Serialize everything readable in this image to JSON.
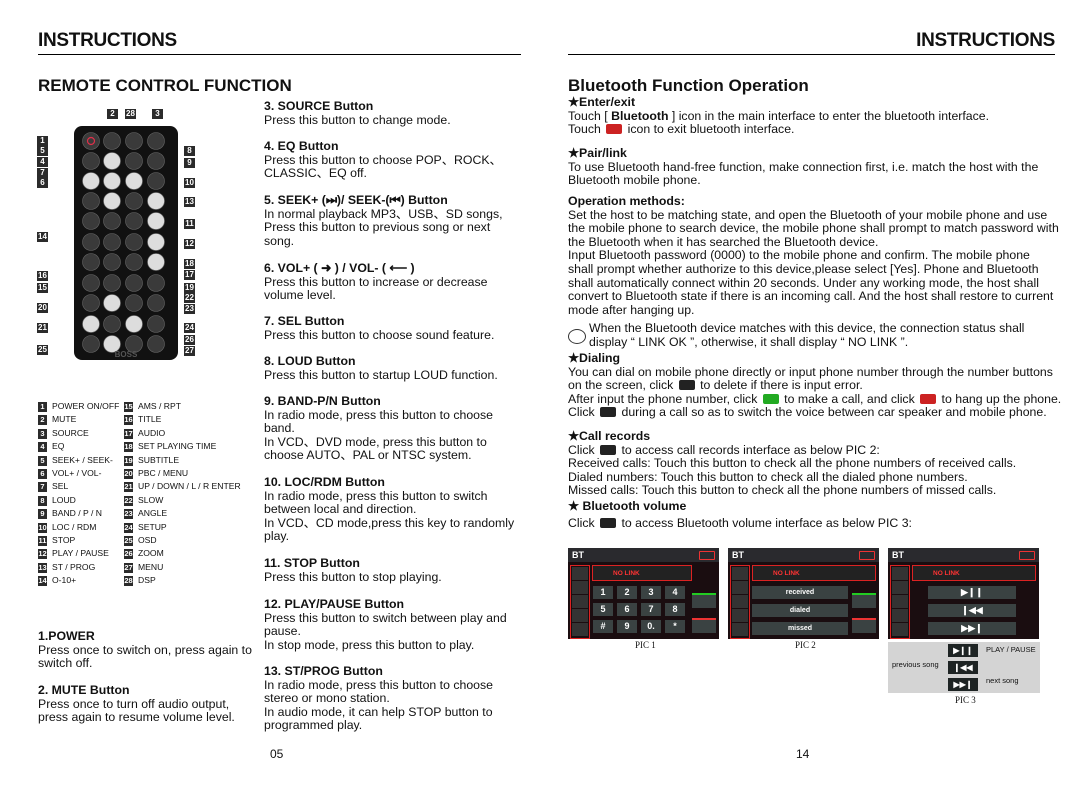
{
  "header": {
    "left": "INSTRUCTIONS",
    "right": "INSTRUCTIONS"
  },
  "left": {
    "section_title": "REMOTE CONTROL FUNCTION",
    "callouts": [
      "1",
      "2",
      "3",
      "4",
      "5",
      "6",
      "7",
      "8",
      "9",
      "10",
      "11",
      "12",
      "13",
      "14",
      "15",
      "16",
      "17",
      "18",
      "19",
      "20",
      "21",
      "22",
      "23",
      "24",
      "25",
      "26",
      "27",
      "28"
    ],
    "remote_brand": "BOSS",
    "legend": [
      [
        "1",
        "POWER ON/OFF"
      ],
      [
        "2",
        "MUTE"
      ],
      [
        "3",
        "SOURCE"
      ],
      [
        "4",
        "EQ"
      ],
      [
        "5",
        "SEEK+ / SEEK-"
      ],
      [
        "6",
        "VOL+ / VOL-"
      ],
      [
        "7",
        "SEL"
      ],
      [
        "8",
        "LOUD"
      ],
      [
        "9",
        "BAND / P / N"
      ],
      [
        "10",
        "LOC / RDM"
      ],
      [
        "11",
        "STOP"
      ],
      [
        "12",
        "PLAY / PAUSE"
      ],
      [
        "13",
        "ST / PROG"
      ],
      [
        "14",
        "O-10+"
      ],
      [
        "15",
        "AMS / RPT"
      ],
      [
        "16",
        "TITLE"
      ],
      [
        "17",
        "AUDIO"
      ],
      [
        "18",
        "SET PLAYING TIME"
      ],
      [
        "19",
        "SUBTITLE"
      ],
      [
        "20",
        "PBC / MENU"
      ],
      [
        "21",
        "UP / DOWN / L / R ENTER"
      ],
      [
        "22",
        "SLOW"
      ],
      [
        "23",
        "ANGLE"
      ],
      [
        "24",
        "SETUP"
      ],
      [
        "25",
        "OSD"
      ],
      [
        "26",
        "ZOOM"
      ],
      [
        "27",
        "MENU"
      ],
      [
        "28",
        "DSP"
      ]
    ],
    "items": [
      {
        "title": "1.POWER",
        "lines": [
          "Press once to switch on, press again to",
          "switch off."
        ]
      },
      {
        "title": "2. MUTE Button",
        "lines": [
          "Press once to turn off audio output,",
          "press again to resume volume level."
        ]
      },
      {
        "title": "3. SOURCE Button",
        "lines": [
          "Press this button to change mode."
        ]
      },
      {
        "title": "4. EQ Button",
        "lines": [
          "Press this button to choose POP、ROCK、",
          "CLASSIC、EQ off."
        ]
      },
      {
        "title": "5. SEEK+ (⏭)/ SEEK-(⏮) Button",
        "lines": [
          "In normal playback MP3、USB、SD songs,",
          "Press this button to previous song or next",
          "song."
        ]
      },
      {
        "title": "6. VOL+ ( ➜ ) / VOL- ( ⟵ )",
        "lines": [
          "Press this button to increase or decrease",
          "volume level."
        ]
      },
      {
        "title": "7. SEL Button",
        "lines": [
          "Press this button to choose sound feature."
        ]
      },
      {
        "title": "8. LOUD Button",
        "lines": [
          "Press this button to startup LOUD function."
        ]
      },
      {
        "title": "9. BAND-P/N Button",
        "lines": [
          "In radio mode, press this button to choose",
          "band.",
          "In VCD、DVD mode, press this button to",
          "choose AUTO、PAL or NTSC system."
        ]
      },
      {
        "title": "10. LOC/RDM Button",
        "lines": [
          "In radio mode, press this button to switch",
          "between local and direction.",
          "In VCD、CD mode,press this key to randomly",
          "play."
        ]
      },
      {
        "title": "11. STOP Button",
        "lines": [
          "Press this button to stop playing."
        ]
      },
      {
        "title": "12. PLAY/PAUSE Button",
        "lines": [
          "Press this button to switch between play and",
          "pause.",
          "In stop mode, press this button to play."
        ]
      },
      {
        "title": "13. ST/PROG Button",
        "lines": [
          "In radio mode, press this button to choose",
          "stereo or mono station.",
          "In audio mode, it can help STOP button to",
          "programmed play."
        ]
      }
    ],
    "page_number": "05"
  },
  "right": {
    "section_title": "Bluetooth Function Operation",
    "blocks": [
      {
        "title": "★Enter/exit",
        "lines": [
          [
            {
              "t": "Touch [ "
            },
            {
              "b": "Bluetooth"
            },
            {
              "t": " ] icon in the main interface to enter the bluetooth interface."
            }
          ],
          [
            {
              "t": "Touch "
            },
            {
              "icon": "exit-icon"
            },
            {
              "t": " icon to exit bluetooth interface."
            }
          ]
        ]
      },
      {
        "title": "★Pair/link",
        "lines": [
          [
            {
              "t": "To use Bluetooth hand-free function, make connection first, i.e. match the host with the"
            }
          ],
          [
            {
              "t": "Bluetooth mobile phone."
            }
          ]
        ]
      },
      {
        "title": "Operation methods:",
        "lines": [
          [
            {
              "t": "Set the host to be matching state, and open the Bluetooth of your mobile phone and use"
            }
          ],
          [
            {
              "t": "the mobile phone to search device, the mobile phone shall prompt to match password with"
            }
          ],
          [
            {
              "t": "the Bluetooth when it has searched the Bluetooth device."
            }
          ],
          [
            {
              "t": "Input Bluetooth password (0000) to the mobile phone and confirm. The mobile phone"
            }
          ],
          [
            {
              "t": "shall prompt whether authorize to this device,please select [Yes]. Phone and Bluetooth"
            }
          ],
          [
            {
              "t": "shall automatically connect within 20 seconds. Under any working mode, the host shall"
            }
          ],
          [
            {
              "t": "convert to Bluetooth state if there is an incoming call. And the host shall restore to current"
            }
          ],
          [
            {
              "t": "mode after hanging up."
            }
          ]
        ]
      },
      {
        "title": "",
        "lines": [
          [
            {
              "t": "When the Bluetooth device matches with this device, the connection status shall"
            }
          ],
          [
            {
              "t": "display “ LINK OK ”, otherwise, it shall display “ NO LINK ”."
            }
          ]
        ]
      },
      {
        "title": "★Dialing",
        "lines": [
          [
            {
              "t": "You can dial on mobile phone directly or input phone number through the number buttons"
            }
          ],
          [
            {
              "t": "on the screen, click "
            },
            {
              "icon": "delete-icon"
            },
            {
              "t": " to delete if there is input error."
            }
          ],
          [
            {
              "t": "After input the phone number, click "
            },
            {
              "icon": "call-icon"
            },
            {
              "t": " to make a call, and click "
            },
            {
              "icon": "hangup-icon"
            },
            {
              "t": " to hang up the phone."
            }
          ],
          [
            {
              "t": "Click "
            },
            {
              "icon": "switch-voice-icon"
            },
            {
              "t": " during a call so as to switch the voice between car speaker and mobile phone."
            }
          ]
        ]
      },
      {
        "title": "★Call records",
        "lines": [
          [
            {
              "t": "Click "
            },
            {
              "icon": "call-records-icon"
            },
            {
              "t": " to access call records interface as below PIC 2:"
            }
          ],
          [
            {
              "t": "Received calls: Touch this button to check all the phone numbers of received calls."
            }
          ],
          [
            {
              "t": "Dialed numbers: Touch this button to check all the dialed phone numbers."
            }
          ],
          [
            {
              "t": "Missed calls: Touch this button to check all the phone numbers of missed calls."
            }
          ]
        ]
      },
      {
        "title": "★ Bluetooth volume",
        "lines": [
          [
            {
              "t": "Click "
            },
            {
              "icon": "music-icon"
            },
            {
              "t": " to access Bluetooth volume interface as  below PIC 3:"
            }
          ]
        ]
      }
    ],
    "pics": {
      "bar_title": "BT",
      "status": "NO LINK",
      "keypad": [
        "1",
        "2",
        "3",
        "4",
        "5",
        "6",
        "7",
        "8",
        "#",
        "9",
        "0.",
        "*"
      ],
      "records": [
        "received",
        "dialed",
        "missed"
      ],
      "labels": [
        "PIC 1",
        "PIC 2",
        "PIC 3"
      ],
      "pic3_callouts": {
        "play": "PLAY / PAUSE",
        "prev": "previous song",
        "next": "next song"
      }
    },
    "page_number": "14"
  },
  "colors": {
    "accent_red": "#dd2222",
    "panel": "#1a0d10"
  }
}
